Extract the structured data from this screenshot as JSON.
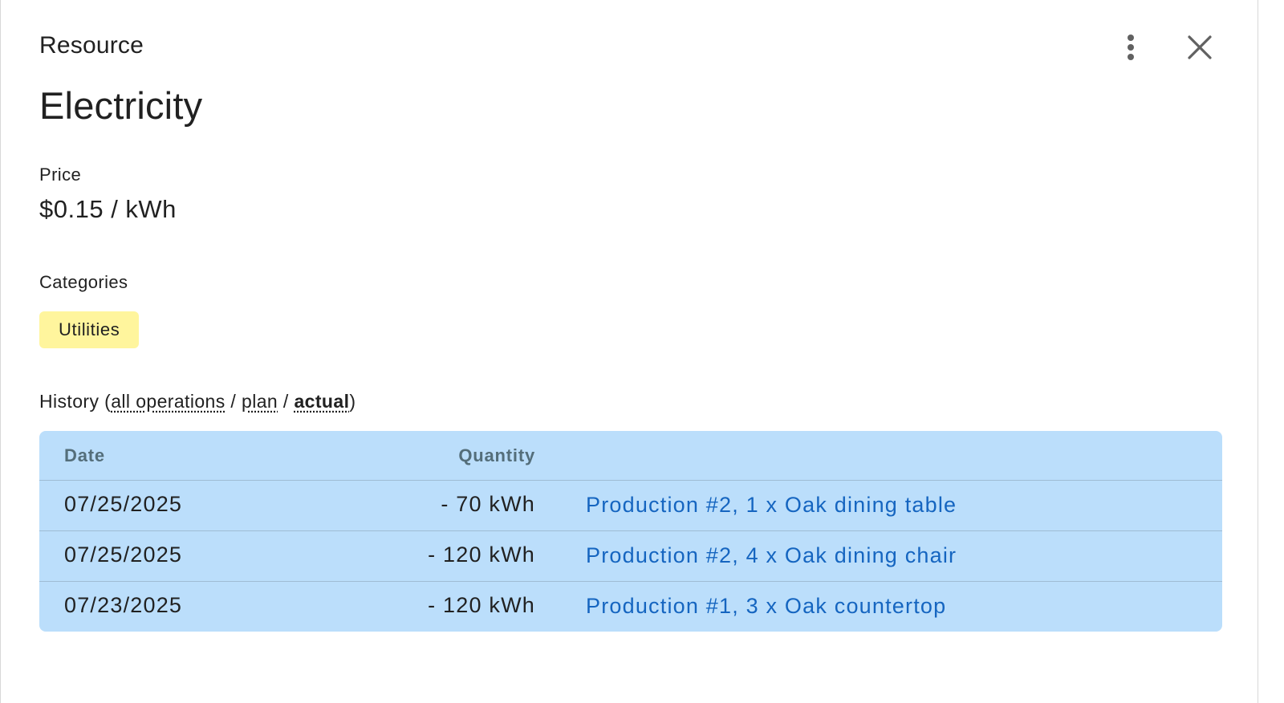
{
  "header": {
    "label": "Resource",
    "title": "Electricity",
    "more_icon": "more-vertical-icon",
    "close_icon": "close-icon"
  },
  "price": {
    "label": "Price",
    "value": "$0.15 / kWh"
  },
  "categories": {
    "label": "Categories",
    "items": [
      "Utilities"
    ],
    "chip_color": "#fff59d"
  },
  "history": {
    "label": "History (",
    "filters": [
      "all operations",
      "plan",
      "actual"
    ],
    "separator": " / ",
    "close_paren": ")",
    "active_filter": "actual",
    "table": {
      "columns": [
        "Date",
        "Quantity"
      ],
      "rows": [
        {
          "date": "07/25/2025",
          "quantity": "- 70 kWh",
          "operation": "Production #2, 1 x Oak dining table"
        },
        {
          "date": "07/25/2025",
          "quantity": "- 120 kWh",
          "operation": "Production #2, 4 x Oak dining chair"
        },
        {
          "date": "07/23/2025",
          "quantity": "- 120 kWh",
          "operation": "Production #1, 3 x Oak countertop"
        }
      ],
      "background": "#bbdefb",
      "link_color": "#1565c0"
    }
  }
}
